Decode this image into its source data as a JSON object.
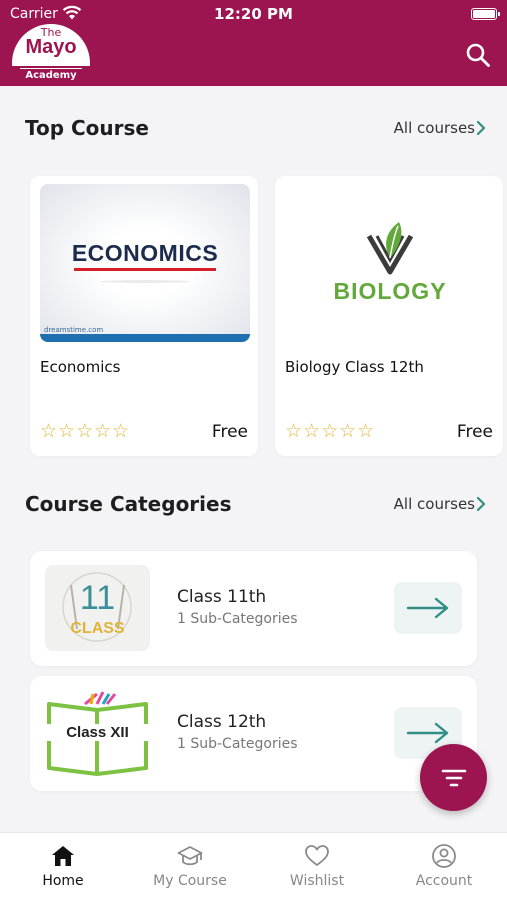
{
  "status": {
    "carrier": "Carrier",
    "time": "12:20 PM"
  },
  "header": {
    "logo_the": "The",
    "logo_mayo": "Mayo",
    "logo_academy": "Academy",
    "search_icon": "search-icon",
    "brand_color": "#9c1450"
  },
  "top_course": {
    "title": "Top Course",
    "all_link": "All courses",
    "courses": [
      {
        "thumb_text": "ECONOMICS",
        "thumb_credit": "dreamstime.com",
        "name": "Economics",
        "rating_stars": 0,
        "price": "Free"
      },
      {
        "thumb_text": "BIOLOGY",
        "name": "Biology Class 12th",
        "rating_stars": 0,
        "price": "Free"
      }
    ]
  },
  "categories": {
    "title": "Course Categories",
    "all_link": "All courses",
    "items": [
      {
        "image_text": "11",
        "image_caption": "CLASS",
        "name": "Class 11th",
        "sub": "1 Sub-Categories"
      },
      {
        "image_text": "Class XII",
        "name": "Class 12th",
        "sub": "1 Sub-Categories"
      }
    ]
  },
  "fab": {
    "icon": "filter-icon"
  },
  "nav": {
    "items": [
      {
        "label": "Home",
        "icon": "home-icon",
        "active": true
      },
      {
        "label": "My Course",
        "icon": "graduation-cap-icon",
        "active": false
      },
      {
        "label": "Wishlist",
        "icon": "heart-icon",
        "active": false
      },
      {
        "label": "Account",
        "icon": "account-icon",
        "active": false
      }
    ]
  }
}
